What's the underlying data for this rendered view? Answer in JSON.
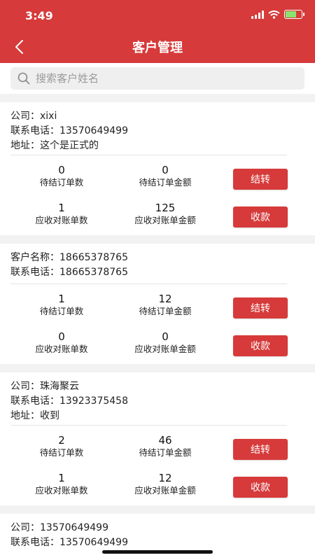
{
  "status_bar": {
    "time": "3:49"
  },
  "header": {
    "title": "客户管理"
  },
  "search": {
    "placeholder": "搜索客户姓名"
  },
  "customers": [
    {
      "lines": [
        "公司：xixi",
        "联系电话：13570649499",
        "地址：这个是正式的"
      ],
      "pending_orders": "0",
      "pending_orders_label": "待结订单数",
      "pending_amount": "0",
      "pending_amount_label": "待结订单金额",
      "transfer_label": "结转",
      "receivable_count": "1",
      "receivable_count_label": "应收对账单数",
      "receivable_amount": "125",
      "receivable_amount_label": "应收对账单金额",
      "collect_label": "收款"
    },
    {
      "lines": [
        "客户名称：18665378765",
        "联系电话：18665378765"
      ],
      "pending_orders": "1",
      "pending_orders_label": "待结订单数",
      "pending_amount": "12",
      "pending_amount_label": "待结订单金额",
      "transfer_label": "结转",
      "receivable_count": "0",
      "receivable_count_label": "应收对账单数",
      "receivable_amount": "0",
      "receivable_amount_label": "应收对账单金额",
      "collect_label": "收款"
    },
    {
      "lines": [
        "公司：珠海聚云",
        "联系电话：13923375458",
        "地址：收到"
      ],
      "pending_orders": "2",
      "pending_orders_label": "待结订单数",
      "pending_amount": "46",
      "pending_amount_label": "待结订单金额",
      "transfer_label": "结转",
      "receivable_count": "1",
      "receivable_count_label": "应收对账单数",
      "receivable_amount": "12",
      "receivable_amount_label": "应收对账单金额",
      "collect_label": "收款"
    },
    {
      "lines": [
        "公司：13570649499",
        "联系电话：13570649499"
      ]
    }
  ],
  "colors": {
    "accent": "#d63a3a",
    "background": "#f2f2f2"
  },
  "icons": {
    "back": "chevron-left-icon",
    "search": "search-icon"
  }
}
